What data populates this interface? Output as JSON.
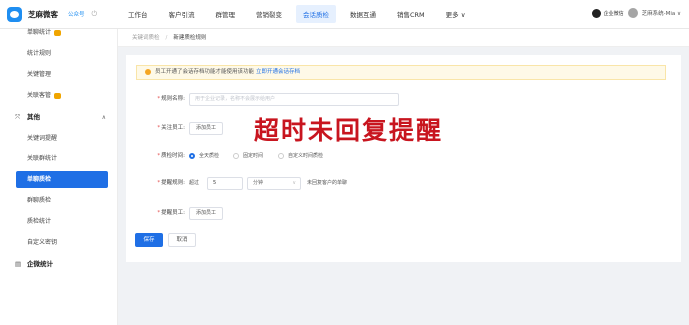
{
  "header": {
    "brand_name": "芝麻微客",
    "brand_tag": "公众号",
    "power_glyph": "⏻",
    "nav": [
      "工作台",
      "客户引流",
      "群管理",
      "营销裂变",
      "会话质检",
      "数据互通",
      "销售CRM"
    ],
    "nav_active": "会话质检",
    "more_label": "更多 ∨",
    "org_label": "企业微信",
    "user_label": "芝麻系统-Mia ∨"
  },
  "sidebar": {
    "items": [
      {
        "label": "单聊统计",
        "badge": true
      },
      {
        "label": "统计规则"
      },
      {
        "label": "关键管理"
      },
      {
        "label": "关联客管",
        "badge": true
      }
    ],
    "group_other": {
      "label": "其他",
      "caret": "∧",
      "icon": "⤧"
    },
    "other_items": [
      "关键词提醒",
      "关联群统计",
      "单聊质检",
      "群聊质检",
      "质检统计",
      "自定义密钥"
    ],
    "active_item": "单聊质检",
    "group_wecom": {
      "label": "企微统计",
      "icon": "▤"
    }
  },
  "breadcrumb": {
    "parent": "关键词质检",
    "separator": "/",
    "current": "新建质检规则"
  },
  "notice": {
    "text": "员工开通了会话存档功能才能使用该功能",
    "link": "立即开通会话存档"
  },
  "form": {
    "rule_name": {
      "label": "规则名称:",
      "placeholder": "用于企业记录，名称不会展示给用户"
    },
    "staff": {
      "label": "关注员工:",
      "button": "添加员工"
    },
    "time": {
      "label": "质检时间:",
      "options": [
        "全天质检",
        "固定时间",
        "自定义时间质检"
      ],
      "selected": 0
    },
    "rule": {
      "label": "提醒规则:",
      "prefix": "超过",
      "value": "5",
      "unit": "分钟",
      "unit_arrow": "∨",
      "suffix": "未回复客户的单聊"
    },
    "notify": {
      "label": "提醒员工:",
      "button": "添加员工"
    },
    "save": "保存",
    "cancel": "取消"
  },
  "overlay": {
    "title": "超时未回复提醒"
  },
  "colors": {
    "primary": "#1f6fe5",
    "overlay_red": "#c8151f",
    "notice_bg": "#fef9e7"
  }
}
